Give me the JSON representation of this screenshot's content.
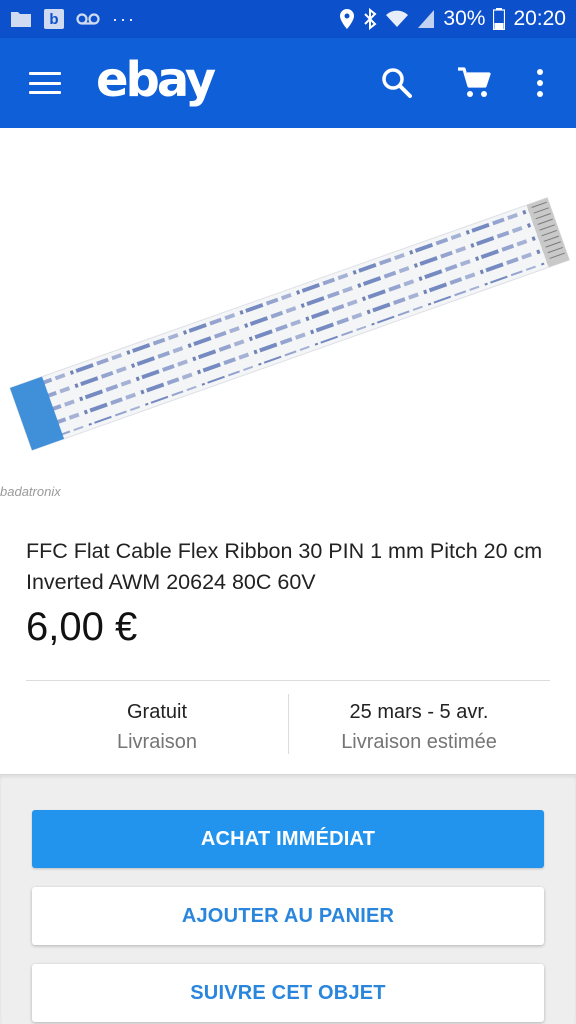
{
  "status_bar": {
    "battery": "30%",
    "time": "20:20",
    "b_label": "b",
    "dots": "···",
    "icons": [
      "folder-icon",
      "b-app-icon",
      "voicemail-icon",
      "more-dots-icon",
      "location-icon",
      "bluetooth-icon",
      "wifi-icon",
      "signal-icon",
      "battery-icon"
    ]
  },
  "app_bar": {
    "logo": "ebay",
    "icons": [
      "menu-icon",
      "search-icon",
      "cart-icon",
      "more-vert-icon"
    ]
  },
  "product": {
    "watermark": "badatronix",
    "title": "FFC Flat Cable Flex Ribbon 30 PIN 1 mm Pitch 20 cm Inverted AWM 20624 80C 60V",
    "price": "6,00 €",
    "shipping": {
      "value": "Gratuit",
      "label": "Livraison"
    },
    "delivery": {
      "value": "25 mars - 5 avr.",
      "label": "Livraison estimée"
    }
  },
  "actions": {
    "buy_now": "ACHAT IMMÉDIAT",
    "add_to_cart": "AJOUTER AU PANIER",
    "watch": "SUIVRE CET OBJET"
  },
  "colors": {
    "status_bar": "#0d50cc",
    "app_bar": "#0f5fd9",
    "primary_button": "#2294ee",
    "secondary_text": "#2a86dc"
  }
}
